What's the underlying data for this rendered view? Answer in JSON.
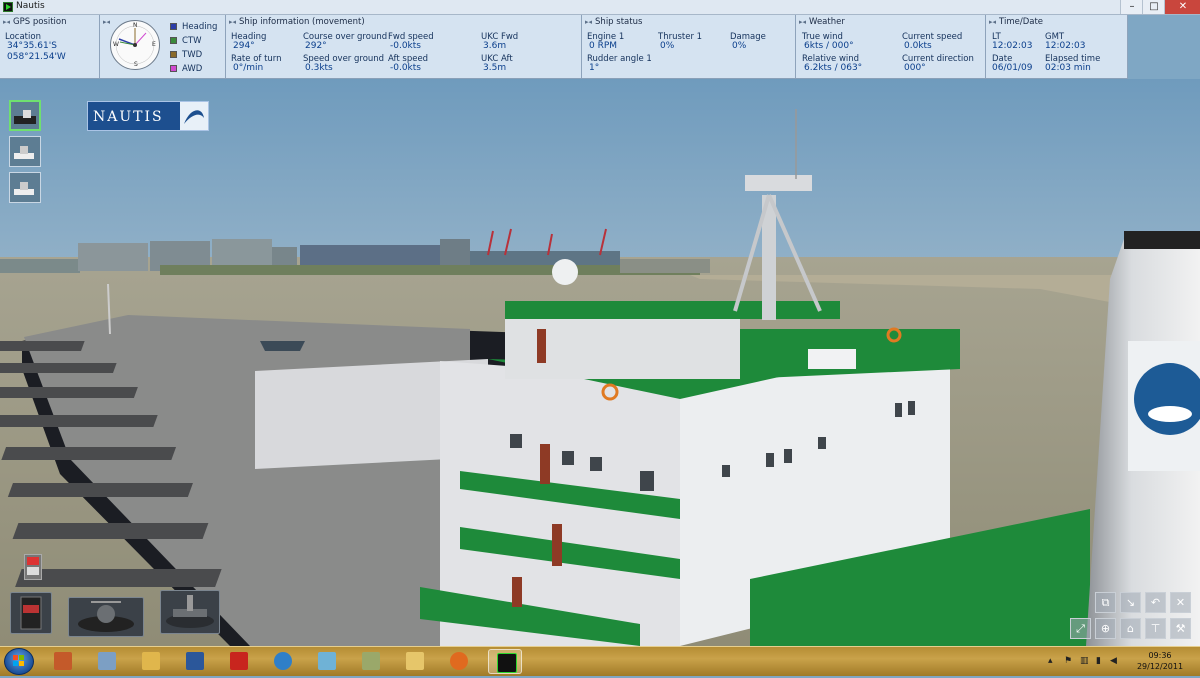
{
  "window": {
    "title": "Nautis",
    "min": "–",
    "max": "□",
    "close": "✕"
  },
  "gps": {
    "header": "GPS position",
    "location_label": "Location",
    "lat": "34°35.61'S",
    "lon": "058°21.54'W"
  },
  "compass": {
    "n": "N",
    "e": "E",
    "s": "S",
    "w": "W",
    "legend": [
      {
        "label": "Heading",
        "color": "#2c3da8"
      },
      {
        "label": "CTW",
        "color": "#3b8a3b"
      },
      {
        "label": "TWD",
        "color": "#8a6a2a"
      },
      {
        "label": "AWD",
        "color": "#d04ad0"
      }
    ]
  },
  "ship_info": {
    "header": "Ship information (movement)",
    "heading_label": "Heading",
    "heading": "294°",
    "cog_label": "Course over ground",
    "cog": "292°",
    "fwd_label": "Fwd speed",
    "fwd": "-0.0kts",
    "ukc_fwd_label": "UKC Fwd",
    "ukc_fwd": "3.6m",
    "rot_label": "Rate of turn",
    "rot": "0°/min",
    "sog_label": "Speed over ground",
    "sog": "0.3kts",
    "aft_label": "Aft speed",
    "aft": "-0.0kts",
    "ukc_aft_label": "UKC Aft",
    "ukc_aft": "3.5m"
  },
  "ship_status": {
    "header": "Ship status",
    "engine_label": "Engine 1",
    "engine": "0 RPM",
    "thruster_label": "Thruster 1",
    "thruster": "0%",
    "damage_label": "Damage",
    "damage": "0%",
    "rudder_label": "Rudder angle 1",
    "rudder": "1°"
  },
  "weather": {
    "header": "Weather",
    "true_wind_label": "True wind",
    "true_wind": "6kts / 000°",
    "current_speed_label": "Current speed",
    "current_speed": "0.0kts",
    "rel_wind_label": "Relative wind",
    "rel_wind": "6.2kts / 063°",
    "current_dir_label": "Current direction",
    "current_dir": "000°"
  },
  "time": {
    "header": "Time/Date",
    "lt_label": "LT",
    "lt": "12:02:03",
    "gmt_label": "GMT",
    "gmt": "12:02:03",
    "date_label": "Date",
    "date": "06/01/09",
    "elapsed_label": "Elapsed time",
    "elapsed": "02:03 min"
  },
  "logo": {
    "text": "NAUTIS"
  },
  "taskbar": {
    "clock_time": "09:36",
    "clock_date": "29/12/2011"
  },
  "colors": {
    "deck_green": "#1e8a3a",
    "panel_bg": "#dce8f4",
    "value_blue": "#0b3f8c"
  }
}
